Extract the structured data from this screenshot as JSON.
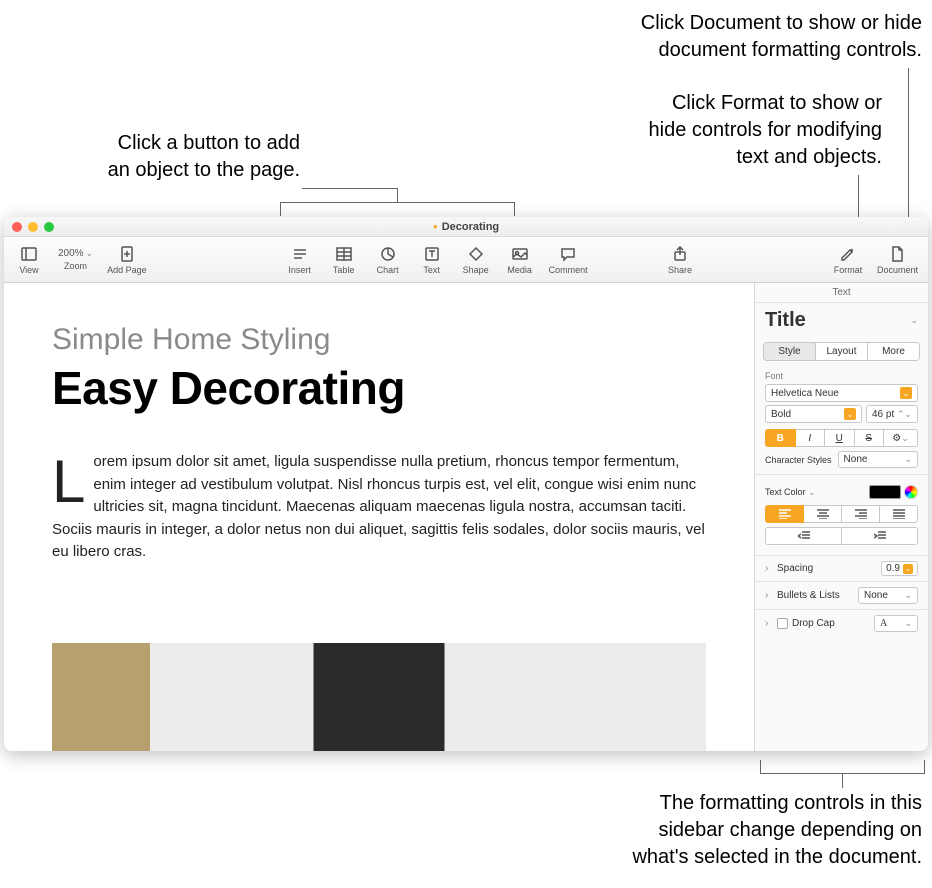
{
  "callouts": {
    "topright1_l1": "Click Document to show or hide",
    "topright1_l2": "document formatting controls.",
    "topright2_l1": "Click Format to show or",
    "topright2_l2": "hide controls for modifying",
    "topright2_l3": "text and objects.",
    "topleft_l1": "Click a button to add",
    "topleft_l2": "an object to the page.",
    "bottom_l1": "The formatting controls in this",
    "bottom_l2": "sidebar change depending on",
    "bottom_l3": "what's selected in the document."
  },
  "window": {
    "title": "Decorating"
  },
  "toolbar": {
    "view": "View",
    "zoom_value": "200%",
    "zoom": "Zoom",
    "add_page": "Add Page",
    "insert": "Insert",
    "table": "Table",
    "chart": "Chart",
    "text": "Text",
    "shape": "Shape",
    "media": "Media",
    "comment": "Comment",
    "share": "Share",
    "format": "Format",
    "document": "Document"
  },
  "page": {
    "subtitle": "Simple Home Styling",
    "headline": "Easy Decorating",
    "dropcap": "L",
    "body": "orem ipsum dolor sit amet, ligula suspendisse nulla pretium, rhoncus tempor fermentum, enim integer ad vestibulum volutpat. Nisl rhoncus turpis est, vel elit, congue wisi enim nunc ultricies sit, magna tincidunt. Maecenas aliquam maecenas ligula nostra, accumsan taciti. Sociis mauris in integer, a dolor netus non dui aliquet, sagittis felis sodales, dolor sociis mauris, vel eu libero cras."
  },
  "sidebar": {
    "header": "Text",
    "style_name": "Title",
    "tabs": {
      "style": "Style",
      "layout": "Layout",
      "more": "More"
    },
    "font_label": "Font",
    "font_family": "Helvetica Neue",
    "font_weight": "Bold",
    "font_size": "46 pt",
    "bold": "B",
    "italic": "I",
    "underline": "U",
    "strike": "S",
    "char_styles_label": "Character Styles",
    "char_styles_value": "None",
    "text_color_label": "Text Color",
    "spacing_label": "Spacing",
    "spacing_value": "0.9",
    "bullets_label": "Bullets & Lists",
    "bullets_value": "None",
    "dropcap_label": "Drop Cap",
    "dropcap_preview": "A"
  }
}
